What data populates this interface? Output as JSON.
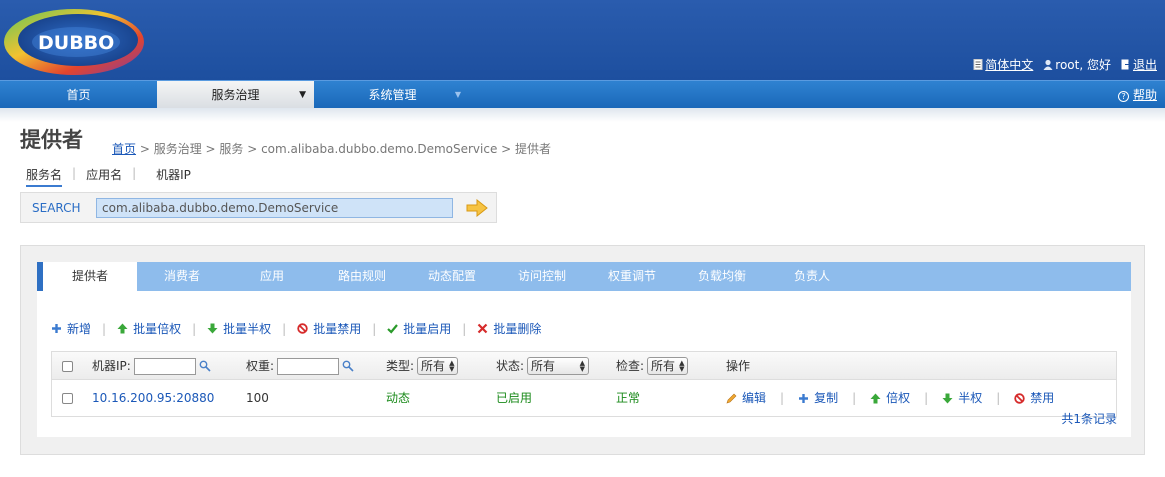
{
  "header": {
    "logo_text": "DUBBO",
    "lang_link": "简体中文",
    "user": "root, 您好",
    "logout": "退出"
  },
  "nav": {
    "items": [
      "首页",
      "服务治理",
      "系统管理"
    ],
    "help": "帮助"
  },
  "page": {
    "title": "提供者",
    "breadcrumb_home": "首页",
    "breadcrumb_rest": " > 服务治理 > 服务 > com.alibaba.dubbo.demo.DemoService > 提供者"
  },
  "search": {
    "tabs": [
      "服务名",
      "应用名",
      "机器IP"
    ],
    "label": "SEARCH",
    "value": "com.alibaba.dubbo.demo.DemoService"
  },
  "tabs": [
    "提供者",
    "消费者",
    "应用",
    "路由规则",
    "动态配置",
    "访问控制",
    "权重调节",
    "负载均衡",
    "负责人"
  ],
  "toolbar": {
    "add": "新增",
    "double": "批量倍权",
    "half": "批量半权",
    "disable": "批量禁用",
    "enable": "批量启用",
    "delete": "批量删除"
  },
  "table": {
    "headers": {
      "ip": "机器IP:",
      "weight": "权重:",
      "type": "类型:",
      "status": "状态:",
      "check": "检查:",
      "ops": "操作"
    },
    "filter_option": "所有",
    "row": {
      "address": "10.16.200.95:20880",
      "weight": "100",
      "type": "动态",
      "status": "已启用",
      "check": "正常",
      "ops": [
        "编辑",
        "复制",
        "倍权",
        "半权",
        "禁用"
      ]
    },
    "total": "共1条记录"
  },
  "colors": {
    "header_bg": "#1d4f9f",
    "nav_bg": "#2f82d1",
    "tab_bar": "#8ebcec",
    "link": "#1b58b8",
    "green": "#1a8a1a"
  }
}
